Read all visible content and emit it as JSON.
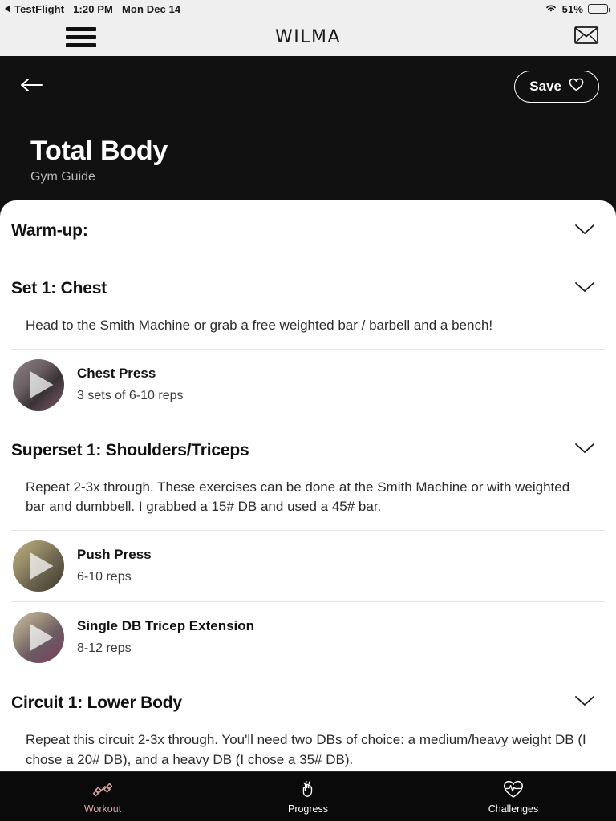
{
  "status_bar": {
    "back_app": "TestFlight",
    "time": "1:20 PM",
    "date": "Mon Dec 14",
    "wifi_icon": "wifi-icon",
    "battery_percent": "51%",
    "battery_level": 51
  },
  "app_bar": {
    "menu_icon": "hamburger-menu-icon",
    "brand": "WILMA",
    "mail_icon": "envelope-icon"
  },
  "hero": {
    "back_icon": "back-arrow-icon",
    "save_label": "Save",
    "save_icon": "heart-outline-icon",
    "title": "Total Body",
    "subtitle": "Gym Guide",
    "background_color": "#111111"
  },
  "sections": [
    {
      "title": "Warm-up:",
      "chevron_icon": "chevron-down-icon",
      "description": null,
      "exercises": []
    },
    {
      "title": "Set 1: Chest",
      "chevron_icon": "chevron-down-icon",
      "description": "Head to the Smith Machine or grab a free weighted bar / barbell and a bench!",
      "exercises": [
        {
          "name": "Chest Press",
          "reps": "3 sets of 6-10 reps",
          "play_icon": "play-icon"
        }
      ]
    },
    {
      "title": "Superset 1: Shoulders/Triceps",
      "chevron_icon": "chevron-down-icon",
      "description": "Repeat 2-3x through. These exercises can be done at the Smith Machine or with weighted bar and dumbbell. I grabbed a 15# DB and used a 45# bar.",
      "exercises": [
        {
          "name": "Push Press",
          "reps": "6-10 reps",
          "play_icon": "play-icon"
        },
        {
          "name": "Single DB Tricep Extension",
          "reps": "8-12 reps",
          "play_icon": "play-icon"
        }
      ]
    },
    {
      "title": "Circuit 1: Lower Body",
      "chevron_icon": "chevron-down-icon",
      "description": "Repeat this circuit 2-3x through. You'll need two DBs of choice: a medium/heavy weight DB (I chose a 20# DB), and a heavy DB (I chose a 35# DB).",
      "exercises": []
    }
  ],
  "tab_bar": {
    "active_color": "#d9a3a3",
    "inactive_color": "#ffffff",
    "tabs": [
      {
        "label": "Workout",
        "icon": "dumbbell-icon",
        "active": true
      },
      {
        "label": "Progress",
        "icon": "clap-hands-icon",
        "active": false
      },
      {
        "label": "Challenges",
        "icon": "heart-pulse-icon",
        "active": false
      }
    ]
  }
}
